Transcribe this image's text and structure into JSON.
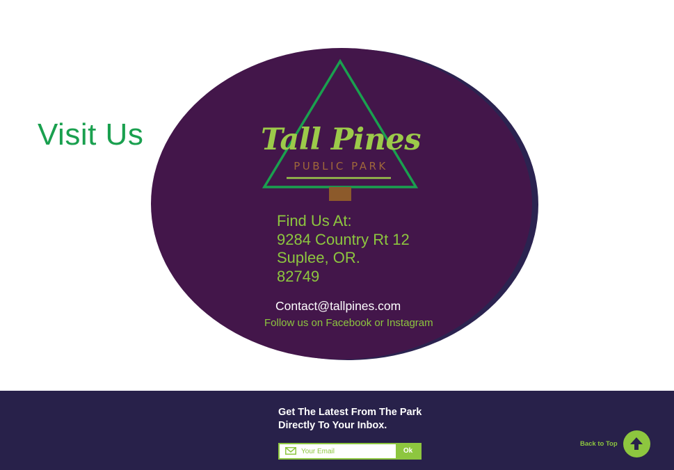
{
  "section": {
    "title": "Visit Us"
  },
  "logo": {
    "name": "Tall Pines",
    "subtitle": "PUBLIC PARK"
  },
  "address": {
    "label": "Find Us At:",
    "street": "9284 Country Rt 12",
    "city_state": "Suplee, OR.",
    "zip": "82749"
  },
  "contact": {
    "email": "Contact@tallpines.com",
    "social": "Follow us on Facebook or Instagram"
  },
  "footer": {
    "newsletter_line1": "Get The Latest From The Park",
    "newsletter_line2": "Directly To Your Inbox.",
    "email_placeholder": "Your Email",
    "submit_label": "Ok",
    "back_to_top_label": "Back to Top"
  },
  "icons": {
    "mail": "mail-icon",
    "back_to_top": "arrow-up-icon",
    "tree": "pine-tree-icon"
  },
  "colors": {
    "accent_green": "#8dc63f",
    "title_green": "#1aa04f",
    "oval_purple": "#43164a",
    "footer_navy": "#28214a",
    "logo_brown": "#a0683a"
  }
}
